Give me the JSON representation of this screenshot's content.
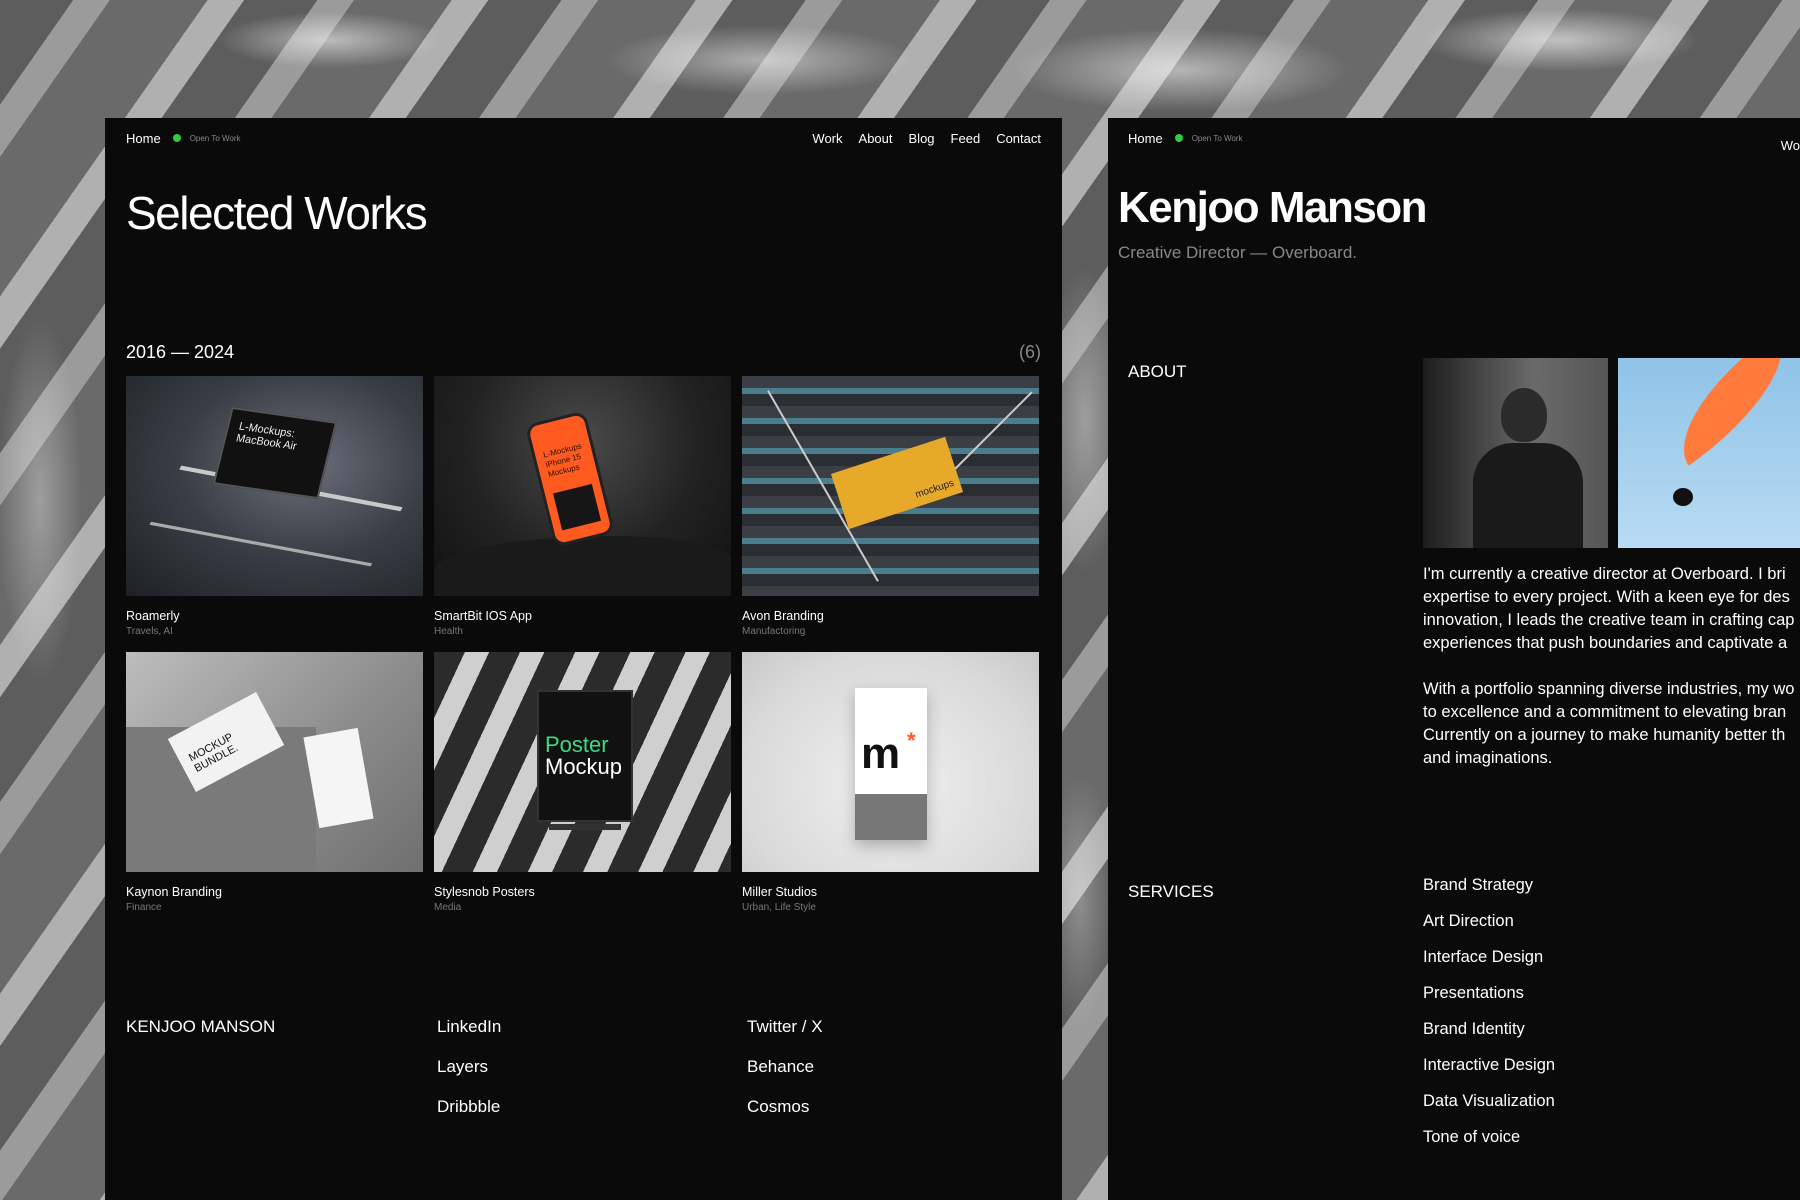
{
  "left": {
    "nav": {
      "home": "Home",
      "status": "Open To Work",
      "links": [
        "Work",
        "About",
        "Blog",
        "Feed",
        "Contact"
      ]
    },
    "title": "Selected Works",
    "years": "2016 — 2024",
    "count": "(6)",
    "works": [
      {
        "name": "Roamerly",
        "tag": "Travels, AI",
        "thumb_text": "L-Mockups: MacBook Air"
      },
      {
        "name": "SmartBit IOS App",
        "tag": "Health",
        "thumb_text": "L-Mockups iPhone 15 Mockups"
      },
      {
        "name": "Avon Branding",
        "tag": "Manufactoring",
        "thumb_text": "mockups"
      },
      {
        "name": "Kaynon Branding",
        "tag": "Finance",
        "thumb_text": "MOCKUP BUNDLE."
      },
      {
        "name": "Stylesnob Posters",
        "tag": "Media",
        "thumb_text_1": "Poster",
        "thumb_text_2": "Mockup"
      },
      {
        "name": "Miller Studios",
        "tag": "Urban, Life Style",
        "thumb_text": "m",
        "thumb_accent": "*"
      }
    ],
    "footer": {
      "brand": "KENJOO MANSON",
      "col1": [
        "LinkedIn",
        "Layers",
        "Dribbble"
      ],
      "col2": [
        "Twitter / X",
        "Behance",
        "Cosmos"
      ]
    }
  },
  "right": {
    "nav": {
      "home": "Home",
      "status": "Open To Work",
      "cut_link": "Wo"
    },
    "title": "Kenjoo Manson",
    "subtitle": "Creative Director  — Overboard.",
    "about_label": "ABOUT",
    "bio": [
      [
        "I'm currently a creative director at Overboard. I bri",
        "expertise to every project. With a keen eye for des",
        "innovation, I leads the creative team in crafting cap",
        "experiences that push boundaries and captivate a"
      ],
      [
        "With a portfolio spanning diverse industries, my wo",
        "to excellence and a commitment to elevating bran",
        "Currently on a journey to make humanity better th",
        "and imaginations."
      ]
    ],
    "services_label": "SERVICES",
    "services": [
      "Brand Strategy",
      "Art Direction",
      "Interface Design",
      "Presentations",
      "Brand Identity",
      "Interactive Design",
      "Data Visualization",
      "Tone of voice"
    ]
  },
  "colors": {
    "panel": "#0a0a0a",
    "status_dot": "#2ecc40",
    "muted": "#888888",
    "accent_orange": "#ff5a1f"
  }
}
